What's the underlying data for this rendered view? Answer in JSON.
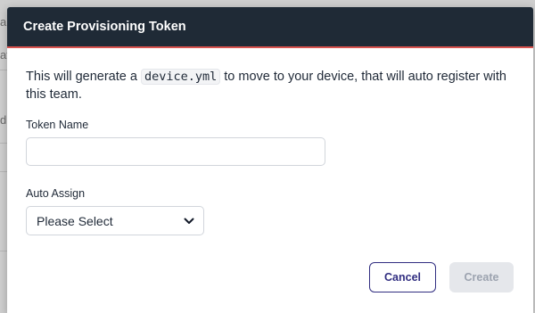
{
  "background": {
    "fragment_1": "ar",
    "fragment_2": "at",
    "fragment_3": "d",
    "row_id": "0b9da006-12ff-4c5f-9623-1c989f5c450f"
  },
  "modal": {
    "title": "Create Provisioning Token",
    "description_before": "This will generate a ",
    "description_code": "device.yml",
    "description_after": " to move to your device, that will auto register with this team.",
    "token_name": {
      "label": "Token Name",
      "value": "",
      "placeholder": ""
    },
    "auto_assign": {
      "label": "Auto Assign",
      "selected": "Please Select"
    },
    "buttons": {
      "cancel": "Cancel",
      "create": "Create"
    }
  },
  "colors": {
    "header_bg": "#1f2a36",
    "header_accent": "#d9534f",
    "cancel_border": "#312e81",
    "create_disabled_bg": "#e5e7eb"
  },
  "icons": {
    "select_chevron": "chevron-down-icon",
    "row_icon": "flow-icon"
  }
}
